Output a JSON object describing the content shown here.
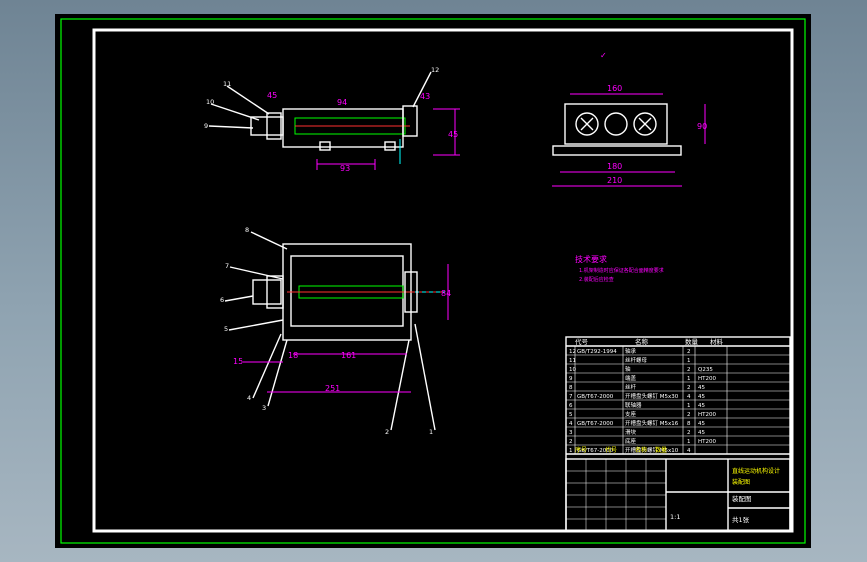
{
  "view_top": {
    "callouts": [
      "11",
      "10",
      "9",
      "12"
    ],
    "dims": {
      "width": "93",
      "left_small": "45",
      "depth": "94",
      "right_small": "43",
      "height": "45"
    }
  },
  "view_side": {
    "dims": {
      "inner": "160",
      "base": "180",
      "overall": "210",
      "height": "90"
    }
  },
  "view_front": {
    "callouts_left": [
      "8",
      "7",
      "6",
      "5",
      "4",
      "3"
    ],
    "callouts_right": [
      "2",
      "1"
    ],
    "dims": {
      "small": "15",
      "mid_a": "18",
      "mid_b": "161",
      "overall": "251",
      "height": "84"
    }
  },
  "notes": {
    "title": "技术要求",
    "lines": [
      "1.机架制造时应保证各配合面精度要求",
      "2.装配后应检查"
    ]
  },
  "bom": {
    "header_row": {
      "code": "代号",
      "name": "名称",
      "qty": "数量",
      "material": "材料"
    },
    "rows": [
      {
        "no": "12",
        "code": "GB/T292-1994",
        "name": "轴承",
        "qty": "2",
        "material": ""
      },
      {
        "no": "11",
        "code": "",
        "name": "丝杆螺母",
        "qty": "1",
        "material": ""
      },
      {
        "no": "10",
        "code": "",
        "name": "轴",
        "qty": "2",
        "material": "Q235"
      },
      {
        "no": "9",
        "code": "",
        "name": "端盖",
        "qty": "1",
        "material": "HT200"
      },
      {
        "no": "8",
        "code": "",
        "name": "丝杆",
        "qty": "2",
        "material": "45"
      },
      {
        "no": "7",
        "code": "GB/T67-2000",
        "name": "开槽盘头螺钉 M5x30",
        "qty": "4",
        "material": "45"
      },
      {
        "no": "6",
        "code": "",
        "name": "联轴器",
        "qty": "1",
        "material": "45"
      },
      {
        "no": "5",
        "code": "",
        "name": "支座",
        "qty": "2",
        "material": "HT200"
      },
      {
        "no": "4",
        "code": "GB/T67-2000",
        "name": "开槽盘头螺钉 M5x16",
        "qty": "8",
        "material": "45"
      },
      {
        "no": "3",
        "code": "",
        "name": "滑块",
        "qty": "2",
        "material": "45"
      },
      {
        "no": "2",
        "code": "",
        "name": "底座",
        "qty": "1",
        "material": "HT200"
      },
      {
        "no": "1",
        "code": "GB/T67-2000",
        "name": "开槽盘头螺钉 M5x10",
        "qty": "4",
        "material": ""
      }
    ],
    "bottom_labels": {
      "no": "序号",
      "code": "代号",
      "name": "名称",
      "qty": "数量"
    }
  },
  "title_block": {
    "title_line1": "直线运动机构设计",
    "title_line2": "装配图",
    "drawing_name": "装配图",
    "scale": "1:1",
    "sheet": "共1张"
  }
}
